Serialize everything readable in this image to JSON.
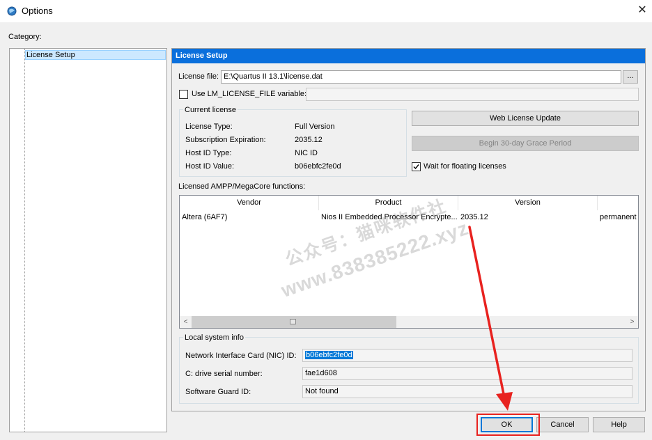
{
  "window": {
    "title": "Options",
    "close_glyph": "✕",
    "icon": "quartus-globe-icon"
  },
  "category_label": "Category:",
  "tree": {
    "items": [
      {
        "label": "License Setup",
        "selected": true
      }
    ]
  },
  "panel": {
    "header": "License Setup",
    "license_file_label": "License file:",
    "license_file_value": "E:\\Quartus II 13.1\\license.dat",
    "browse_label": "...",
    "use_lm_label": "Use LM_LICENSE_FILE variable:",
    "use_lm_checked": false,
    "use_lm_value": "",
    "current_license": {
      "title": "Current license",
      "rows": [
        {
          "label": "License Type:",
          "value": "Full Version"
        },
        {
          "label": "Subscription Expiration:",
          "value": "2035.12"
        },
        {
          "label": "Host ID Type:",
          "value": "NIC ID"
        },
        {
          "label": "Host ID Value:",
          "value": "b06ebfc2fe0d"
        }
      ]
    },
    "web_update_label": "Web License Update",
    "grace_label": "Begin 30-day Grace Period",
    "wait_floating_label": "Wait for floating licenses",
    "wait_floating_checked": true,
    "ampp_label": "Licensed AMPP/MegaCore functions:",
    "table": {
      "columns": [
        "Vendor",
        "Product",
        "Version",
        ""
      ],
      "rows": [
        [
          "Altera (6AF7)",
          "Nios II Embedded Processor Encrypte...",
          "2035.12",
          "permanent"
        ]
      ],
      "scroll_left": "<",
      "scroll_right": ">"
    },
    "local_info": {
      "title": "Local system info",
      "nic_label": "Network Interface Card (NIC) ID:",
      "nic_value": "b06ebfc2fe0d",
      "cdrive_label": "C: drive serial number:",
      "cdrive_value": "fae1d608",
      "guard_label": "Software Guard ID:",
      "guard_value": "Not found"
    }
  },
  "buttons": {
    "ok": "OK",
    "cancel": "Cancel",
    "help": "Help"
  },
  "watermark": {
    "line1": "公众号：猫咪软件社",
    "line2": "www.838385222.xyz"
  },
  "colors": {
    "header_blue": "#0a6fdc",
    "selection_blue": "#cce8ff",
    "annotation_red": "#e8221f",
    "input_selection": "#0078d7"
  }
}
